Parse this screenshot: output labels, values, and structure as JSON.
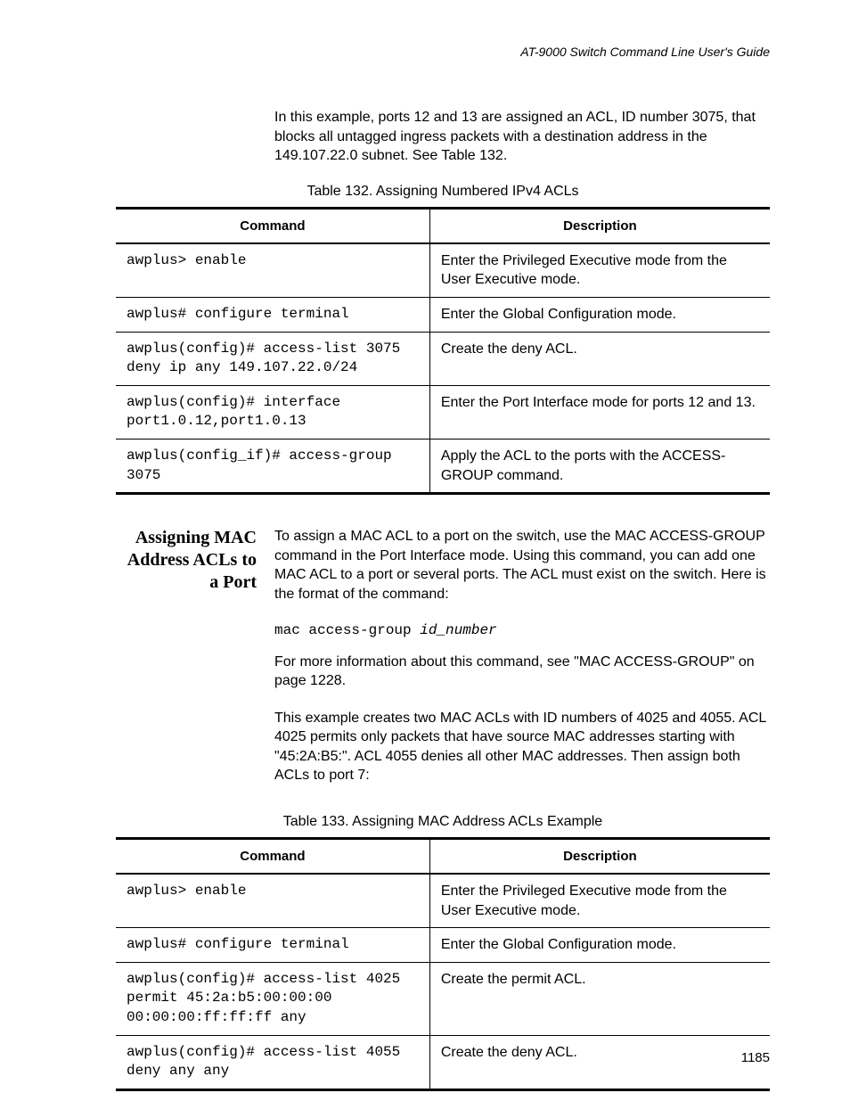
{
  "header": {
    "guideTitle": "AT-9000 Switch Command Line User's Guide"
  },
  "intro": {
    "para1": "In this example, ports 12 and 13 are assigned an ACL, ID number 3075, that blocks all untagged ingress packets with a destination address in the 149.107.22.0 subnet. See Table 132."
  },
  "table132": {
    "caption": "Table 132. Assigning Numbered IPv4 ACLs",
    "headerCommand": "Command",
    "headerDescription": "Description",
    "rows": [
      {
        "cmd": "awplus> enable",
        "desc": "Enter the Privileged Executive mode from the User Executive mode."
      },
      {
        "cmd": "awplus# configure terminal",
        "desc": "Enter the Global Configuration mode."
      },
      {
        "cmd": "awplus(config)# access-list 3075 deny ip any 149.107.22.0/24",
        "desc": "Create the deny ACL."
      },
      {
        "cmd": "awplus(config)# interface port1.0.12,port1.0.13",
        "desc": "Enter the Port Interface mode for ports 12 and 13."
      },
      {
        "cmd": "awplus(config_if)# access-group 3075",
        "desc": "Apply the ACL to the ports with the ACCESS-GROUP command."
      }
    ]
  },
  "section2": {
    "title": "Assigning MAC Address ACLs to a Port",
    "para1": "To assign a MAC ACL to a port on the switch, use the MAC ACCESS-GROUP command in the Port Interface mode. Using this command, you can add one MAC ACL to a port or several ports. The ACL must exist on the switch. Here is the format of the command:",
    "codePrefix": "mac access-group ",
    "codeItalic": "id_number",
    "para2": "For more information about this command, see \"MAC ACCESS-GROUP\" on page 1228.",
    "para3": "This example creates two MAC ACLs with ID numbers of 4025 and 4055. ACL 4025 permits only packets that have source MAC addresses starting with \"45:2A:B5:\". ACL 4055 denies all other MAC addresses. Then assign both ACLs to port 7:"
  },
  "table133": {
    "caption": "Table 133. Assigning MAC Address ACLs Example",
    "headerCommand": "Command",
    "headerDescription": "Description",
    "rows": [
      {
        "cmd": "awplus> enable",
        "desc": "Enter the Privileged Executive mode from the User Executive mode."
      },
      {
        "cmd": "awplus# configure terminal",
        "desc": "Enter the Global Configuration mode."
      },
      {
        "cmd": "awplus(config)# access-list 4025 permit 45:2a:b5:00:00:00 00:00:00:ff:ff:ff any",
        "desc": "Create the permit ACL."
      },
      {
        "cmd": "awplus(config)# access-list 4055 deny any any",
        "desc": "Create the deny ACL."
      }
    ]
  },
  "pageNumber": "1185"
}
